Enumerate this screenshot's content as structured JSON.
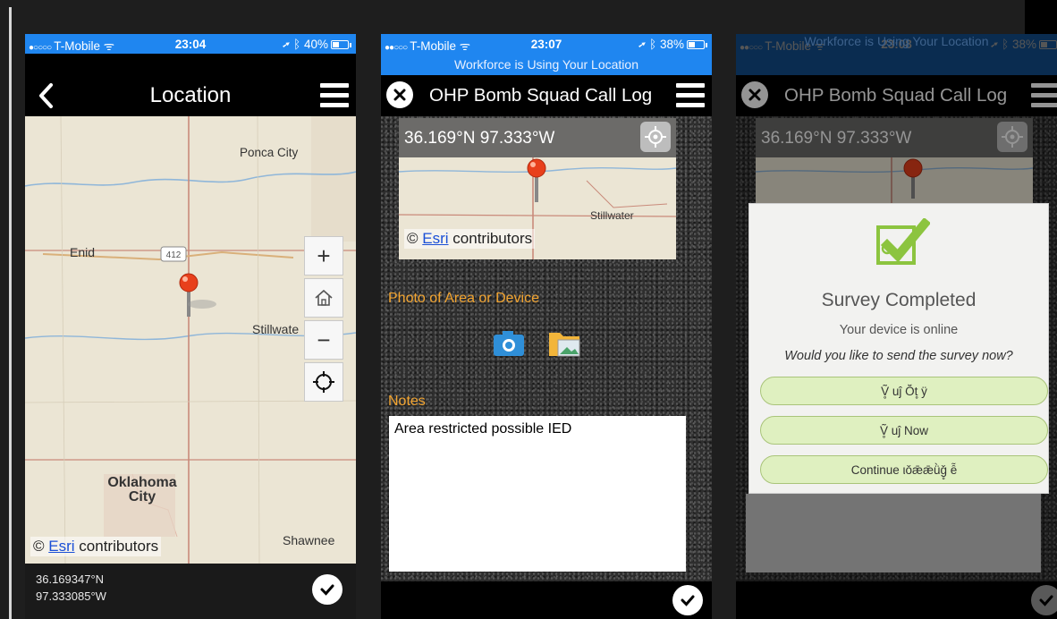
{
  "phone1": {
    "status": {
      "carrier": "T-Mobile",
      "time": "23:04",
      "battery": "40%"
    },
    "nav_title": "Location",
    "map": {
      "places": [
        "Ponca City",
        "Enid",
        "Stillwate",
        "Oklahoma City",
        "Shawnee"
      ],
      "highway": "412",
      "attribution_prefix": "©",
      "attribution_link": "Esri",
      "attribution_suffix": "contributors"
    },
    "map_controls": [
      "zoom-in",
      "home",
      "zoom-out",
      "locate"
    ],
    "lat": "36.169347°N",
    "lon": "97.333085°W"
  },
  "phone2": {
    "status": {
      "carrier": "T-Mobile",
      "time": "23:07",
      "battery": "38%",
      "banner": "Workforce is Using Your Location"
    },
    "nav_title": "OHP Bomb Squad Call Log",
    "mini_coords": "36.169°N 97.333°W",
    "mini_place": "Stillwater",
    "attribution_prefix": "©",
    "attribution_link": "Esri",
    "attribution_suffix": "contributors",
    "photo_label": "Photo of Area or Device",
    "notes_label": "Notes",
    "notes_value": "Area restricted possible IED"
  },
  "phone3": {
    "status": {
      "carrier": "T-Mobile",
      "time": "23:08",
      "battery": "38%",
      "banner": "Workforce is Using Your Location"
    },
    "nav_title": "OHP Bomb Squad Call Log",
    "mini_coords": "36.169°N 97.333°W",
    "modal": {
      "title": "Survey Completed",
      "online": "Your device is online",
      "question": "Would you like to send the survey now?",
      "buttons": [
        "Ṽ̥ uĵ  Ǒ̈t̥ ÿ",
        "Ṽ̥ uĵ  Now",
        "Continue ιǒǣǣǜǧ̥ ễ"
      ]
    }
  },
  "colors": {
    "status_blue": "#1f86f0",
    "section_orange": "#f3a531",
    "modal_button": "#dff0c0",
    "pin_red": "#e8401c"
  }
}
